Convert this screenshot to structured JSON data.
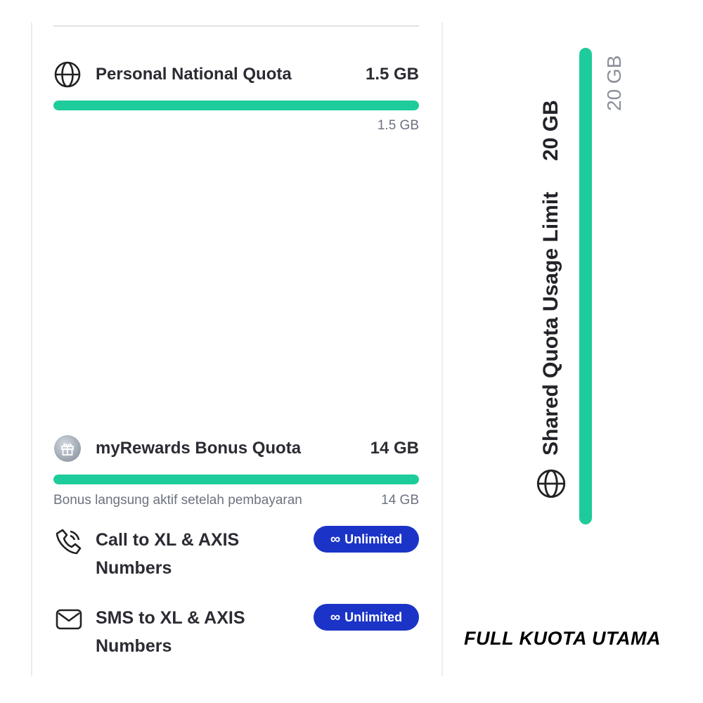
{
  "personal_quota": {
    "title": "Personal National Quota",
    "amount": "1.5 GB",
    "remaining": "1.5 GB",
    "fill_fraction": 1.0,
    "icon": "globe-icon"
  },
  "rewards_quota": {
    "title": "myRewards Bonus Quota",
    "amount": "14 GB",
    "note": "Bonus langsung aktif setelah pembayaran",
    "remaining": "14 GB",
    "fill_fraction": 1.0,
    "icon": "gift-icon"
  },
  "features": [
    {
      "label": "Call to  XL & AXIS\nNumbers",
      "badge": "Unlimited",
      "badge_symbol": "∞",
      "icon": "phone-icon"
    },
    {
      "label": "SMS to  XL & AXIS\nNumbers",
      "badge": "Unlimited",
      "badge_symbol": "∞",
      "icon": "envelope-icon"
    }
  ],
  "shared_quota": {
    "title": "Shared Quota Usage Limit",
    "amount": "20 GB",
    "remaining": "20 GB",
    "fill_fraction": 1.0,
    "icon": "globe-icon"
  },
  "caption": "FULL KUOTA UTAMA",
  "colors": {
    "progress": "#1dcc9a",
    "badge": "#1b34c7",
    "text": "#2b2b33",
    "muted": "#6c7280"
  }
}
